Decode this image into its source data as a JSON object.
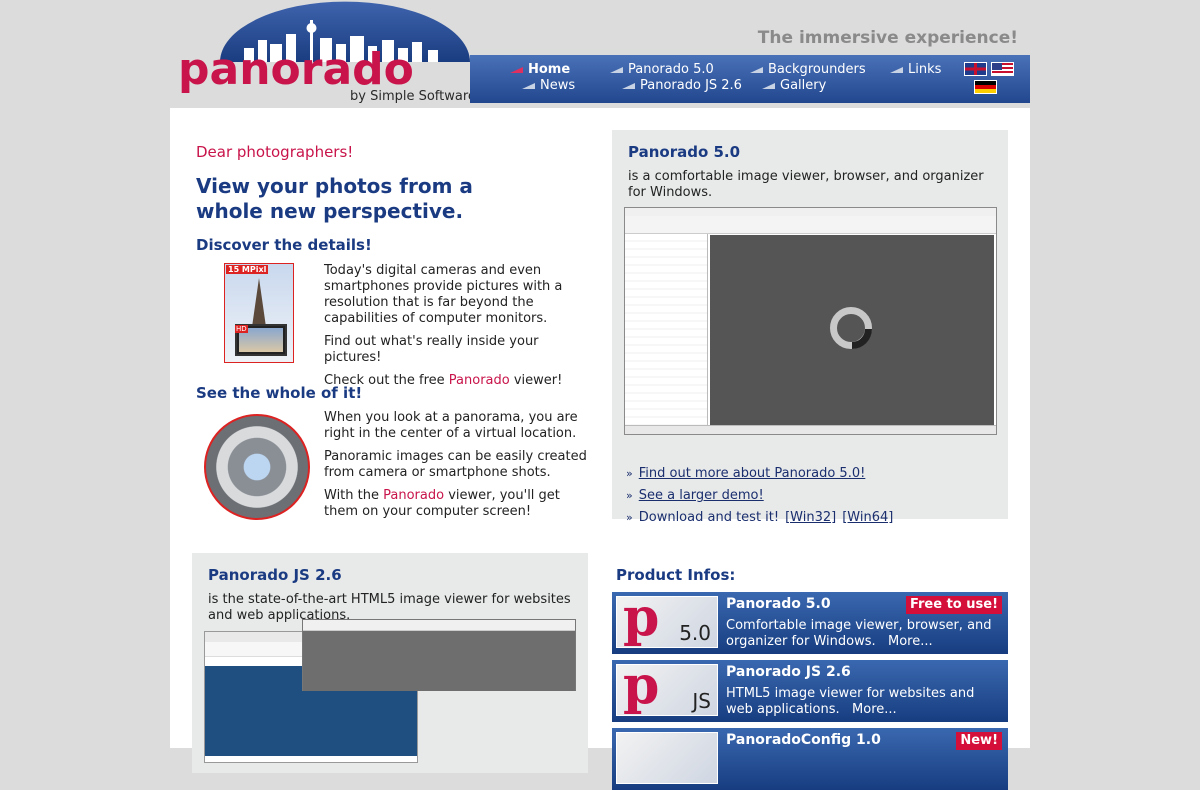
{
  "header": {
    "logo_word": "panorado",
    "logo_by": "by Simple Software",
    "tagline": "The immersive experience!",
    "nav": [
      {
        "label": "Home"
      },
      {
        "label": "News"
      },
      {
        "label": "Panorado 5.0"
      },
      {
        "label": "Panorado JS 2.6"
      },
      {
        "label": "Backgrounders"
      },
      {
        "label": "Gallery"
      },
      {
        "label": "Links"
      }
    ],
    "flags": [
      "uk-flag-icon",
      "us-flag-icon",
      "de-flag-icon"
    ]
  },
  "intro": {
    "greeting": "Dear photographers!",
    "headline": "View your photos from a whole new perspective.",
    "details_heading": "Discover the details!",
    "details_p1": "Today's digital cameras and even smartphones provide pictures with a resolution that is far beyond the capabilities of computer monitors.",
    "details_p2": "Find out what's really inside your pictures!",
    "details_p3_pre": "Check out the free ",
    "details_p3_brand": "Panorado",
    "details_p3_post": " viewer!",
    "tower_badge": "15 MPixl",
    "tower_hd": "HD",
    "whole_heading": "See the whole of it!",
    "whole_p1": "When you look at a panorama, you are right in the center of a virtual location.",
    "whole_p2": "Panoramic images can be easily created from camera or smartphone shots.",
    "whole_p3_pre": "With the ",
    "whole_p3_brand": "Panorado",
    "whole_p3_post": " viewer, you'll get them on your computer screen!"
  },
  "panorado5_box": {
    "title": "Panorado 5.0",
    "desc": "is a comfortable image viewer, browser, and organizer for Windows.",
    "links": {
      "find_out": "Find out more about Panorado 5.0!",
      "larger_demo": "See a larger demo!",
      "download_pre": "Download and test it!",
      "win32": "[Win32]",
      "win64": "[Win64]"
    }
  },
  "panoradojs_box": {
    "title": "Panorado JS 2.6",
    "desc": "is the state-of-the-art HTML5 image viewer for websites and web applications."
  },
  "product_infos": {
    "heading": "Product Infos:",
    "cards": [
      {
        "name": "Panorado 5.0",
        "badge": "Free to use!",
        "logo_version": "5.0",
        "desc": "Comfortable image viewer, browser, and organizer for Windows.",
        "more": "More..."
      },
      {
        "name": "Panorado JS 2.6",
        "badge": "",
        "logo_version": "JS",
        "desc": "HTML5 image viewer for websites and web applications.",
        "more": "More..."
      },
      {
        "name": "PanoradoConfig 1.0",
        "badge": "New!",
        "logo_version": "",
        "desc": "",
        "more": ""
      }
    ]
  },
  "colors": {
    "brand_crimson": "#c8144a",
    "nav_blue": "#22478f",
    "heading_navy": "#1a3a82"
  }
}
